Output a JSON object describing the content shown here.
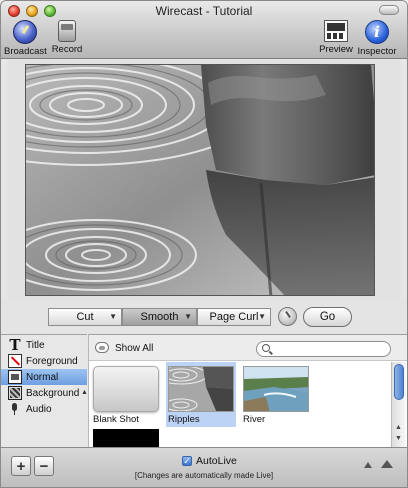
{
  "window": {
    "title": "Wirecast - Tutorial"
  },
  "toolbar": {
    "broadcast_label": "Broadcast",
    "record_label": "Record",
    "preview_label": "Preview",
    "inspector_label": "Inspector",
    "inspector_glyph": "i"
  },
  "transitions": {
    "cut_label": "Cut",
    "smooth_label": "Smooth",
    "pagecurl_label": "Page Curl",
    "selected": "Smooth",
    "go_label": "Go",
    "arrow_glyph": "▼"
  },
  "layers": {
    "items": [
      {
        "label": "Title",
        "icon": "title-icon",
        "glyph": "T"
      },
      {
        "label": "Foreground",
        "icon": "foreground-icon"
      },
      {
        "label": "Normal",
        "icon": "normal-icon",
        "selected": true
      },
      {
        "label": "Background",
        "icon": "background-icon"
      },
      {
        "label": "Audio",
        "icon": "audio-icon"
      }
    ],
    "caret_glyph": "▲"
  },
  "shots": {
    "show_all_label": "Show All",
    "search_placeholder": "",
    "items": [
      {
        "label": "Blank Shot"
      },
      {
        "label": "Ripples",
        "selected": true
      },
      {
        "label": "River"
      },
      {
        "label": ""
      }
    ],
    "scroll_up_glyph": "▲",
    "scroll_down_glyph": "▼"
  },
  "bottom": {
    "add_glyph": "+",
    "remove_glyph": "−",
    "autolive_label": "AutoLive",
    "autolive_checked": true,
    "check_glyph": "✓",
    "autolive_note": "[Changes are automatically made Live]"
  },
  "colors": {
    "selection": "#6f9ee0",
    "shot_selection": "#bcd3f5",
    "checkbox": "#3a74d1"
  }
}
